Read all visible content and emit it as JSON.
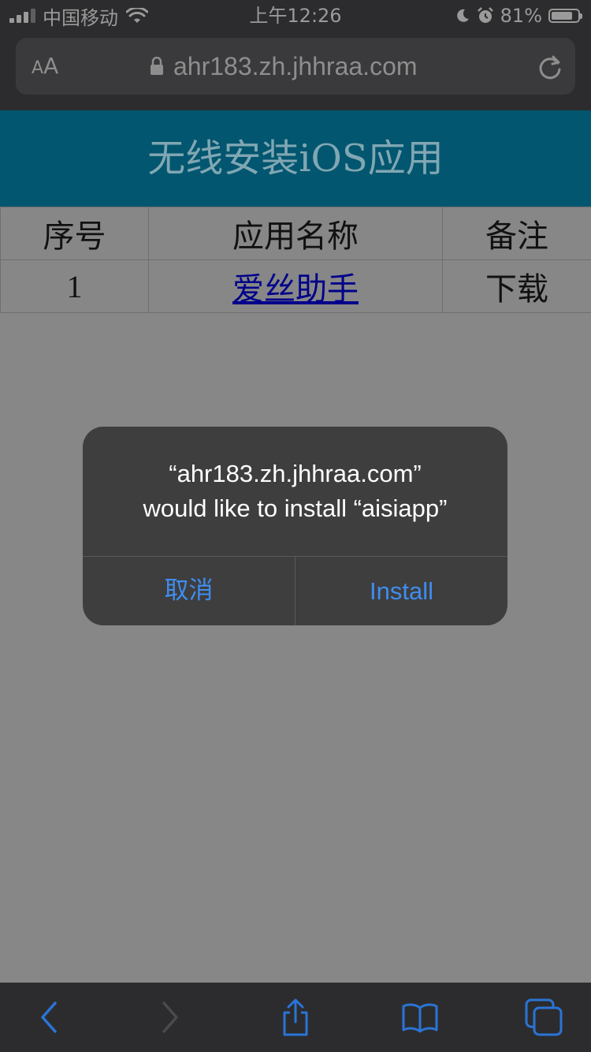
{
  "status_bar": {
    "carrier": "中国移动",
    "time": "上午12:26",
    "battery_percent_text": "81%",
    "battery_level": 0.81
  },
  "browser": {
    "text_size_small": "A",
    "text_size_large": "A",
    "url": "ahr183.zh.jhhraa.com"
  },
  "page": {
    "title": "无线安装iOS应用",
    "table": {
      "headers": [
        "序号",
        "应用名称",
        "备注"
      ],
      "rows": [
        {
          "index": "1",
          "name": "爱丝助手",
          "note": "下载"
        }
      ]
    }
  },
  "alert": {
    "line1": "“ahr183.zh.jhhraa.com”",
    "line2": "would like to install “aisiapp”",
    "cancel_label": "取消",
    "install_label": "Install"
  },
  "colors": {
    "header_bg": "#03566f",
    "dim_overlay": "#878787",
    "link": "#00008b",
    "alert_button": "#3f8df0",
    "toolbar_icon": "#2a74d6"
  },
  "toolbar": {
    "icons": [
      "back-icon",
      "forward-icon",
      "share-icon",
      "bookmarks-icon",
      "tabs-icon"
    ]
  }
}
